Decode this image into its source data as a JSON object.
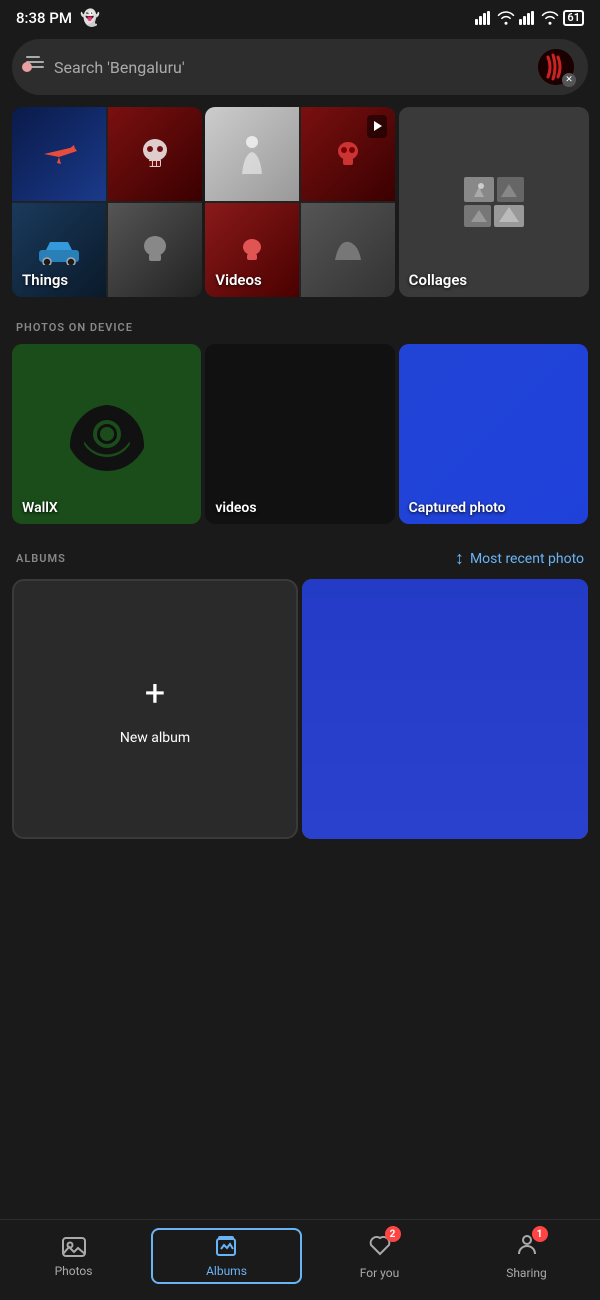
{
  "statusBar": {
    "time": "8:38 PM",
    "snapchatIcon": "👻",
    "batteryLevel": "61"
  },
  "searchBar": {
    "placeholder": "Search 'Bengaluru'"
  },
  "sections": {
    "things": {
      "label": "Things"
    },
    "videos": {
      "label": "Videos"
    },
    "collages": {
      "label": "Collages"
    }
  },
  "photosOnDevice": {
    "sectionTitle": "PHOTOS ON DEVICE",
    "items": [
      {
        "label": "WallX"
      },
      {
        "label": "videos"
      },
      {
        "label": "Captured photo"
      }
    ]
  },
  "albums": {
    "sectionTitle": "ALBUMS",
    "sortLabel": "Most recent photo",
    "newAlbumLabel": "New album",
    "plusIcon": "+"
  },
  "bottomNav": {
    "items": [
      {
        "label": "Photos",
        "icon": "photos"
      },
      {
        "label": "Albums",
        "icon": "albums",
        "active": true
      },
      {
        "label": "For you",
        "icon": "for-you",
        "badge": "2"
      },
      {
        "label": "Sharing",
        "icon": "sharing",
        "badge": "1"
      }
    ]
  }
}
